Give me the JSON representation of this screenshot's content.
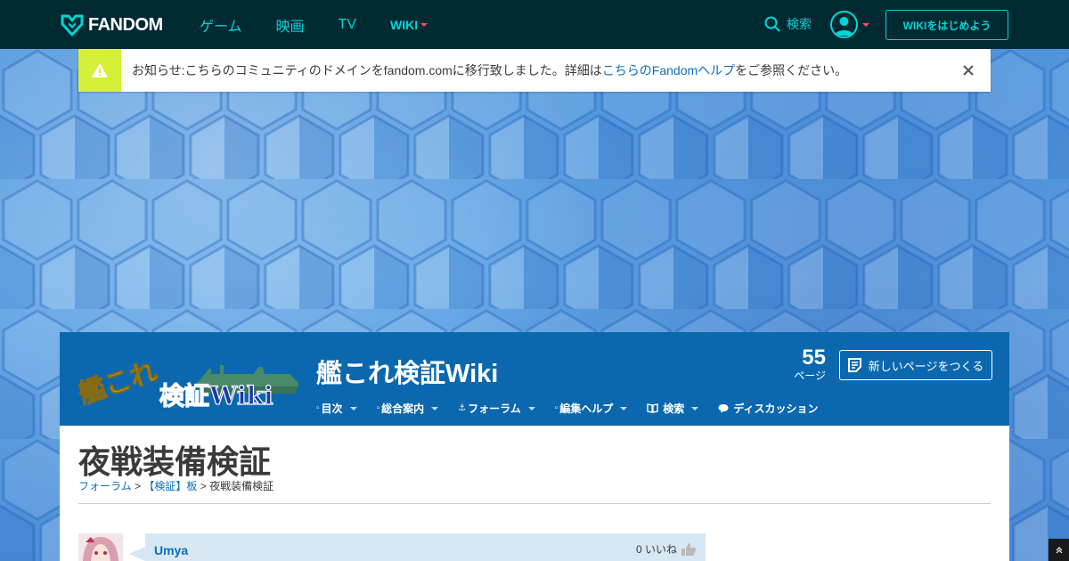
{
  "topbar": {
    "brand": "FANDOM",
    "nav": [
      {
        "label": "ゲーム"
      },
      {
        "label": "映画"
      },
      {
        "label": "TV"
      },
      {
        "label": "WIKI"
      }
    ],
    "search_label": "検索",
    "start_wiki_label": "WIKIをはじめよう"
  },
  "notice": {
    "text_before": "お知らせ:こちらのコミュニティのドメインをfandom.comに移行致しました。詳細は",
    "link_text": "こちらのFandomヘルプ",
    "text_after": "をご参照ください。"
  },
  "wiki": {
    "logo_text_1": "艦これ",
    "logo_text_2": "検証Wiki",
    "title": "艦これ検証Wiki",
    "page_count": "55",
    "page_count_label": "ページ",
    "new_page_label": "新しいページをつくる",
    "nav": [
      {
        "label": "目次"
      },
      {
        "label": "総合案内"
      },
      {
        "label": "フォーラム"
      },
      {
        "label": "編集ヘルプ"
      },
      {
        "label": "検索"
      },
      {
        "label": "ディスカッション"
      }
    ]
  },
  "page": {
    "heading": "夜戦装備検証",
    "breadcrumb": [
      {
        "label": "フォーラム"
      },
      {
        "label": "【検証】板"
      },
      {
        "label": "夜戦装備検証"
      }
    ],
    "breadcrumb_sep": ">"
  },
  "post": {
    "user": "Umya",
    "likes": "0 いいね"
  },
  "colors": {
    "topbar_bg": "#002a32",
    "accent": "#00d6d6",
    "wiki_header_bg": "#0b68ae",
    "notice_warning": "#d6f03a",
    "link": "#0d6fb8"
  }
}
